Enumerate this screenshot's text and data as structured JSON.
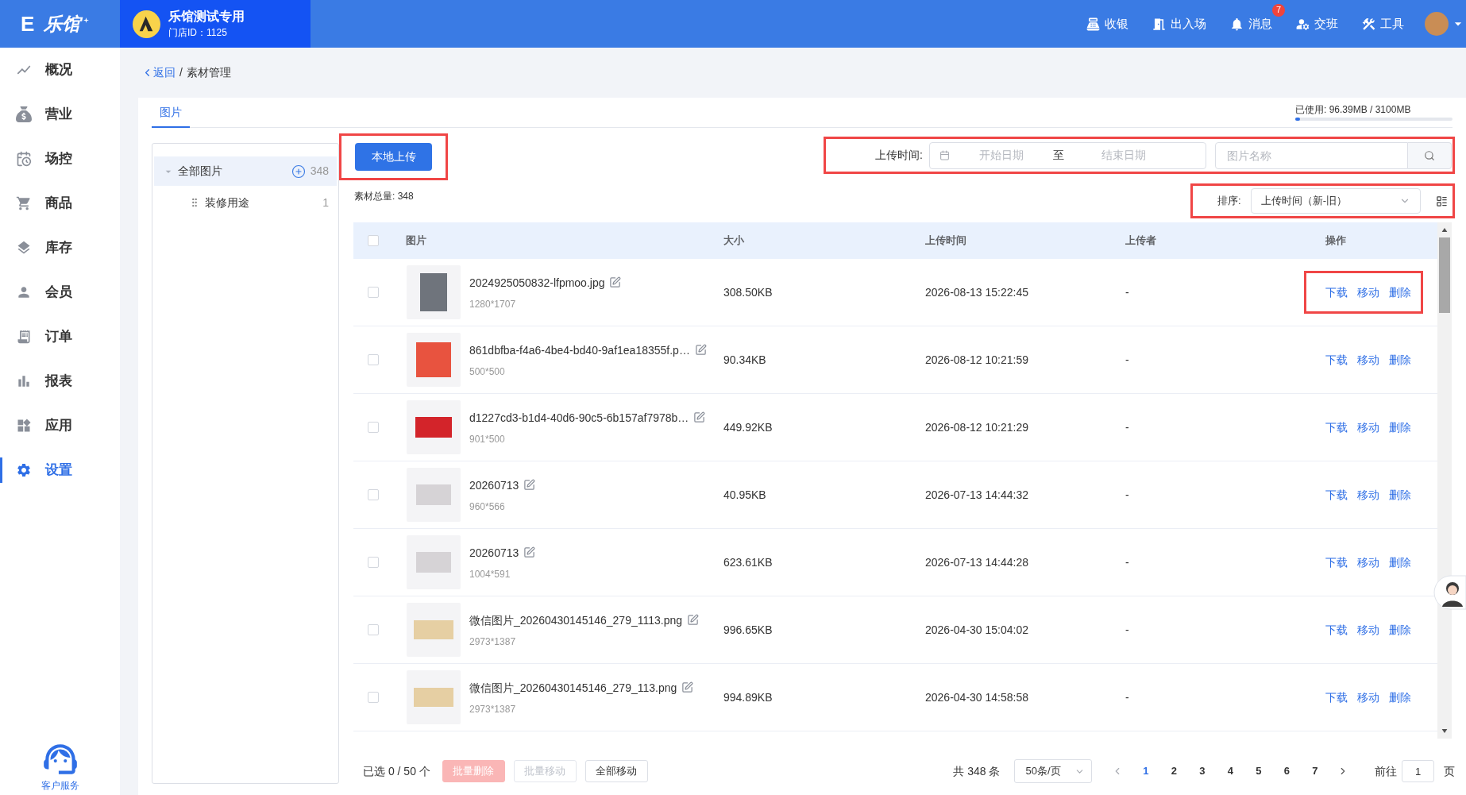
{
  "top_bar": {
    "logo": {
      "mark": "E",
      "name": "乐馆"
    },
    "store": {
      "name": "乐馆测试专用",
      "id": "门店ID：1125"
    },
    "actions": [
      {
        "label": "收银"
      },
      {
        "label": "出入场"
      },
      {
        "label": "消息",
        "badge": "7"
      },
      {
        "label": "交班"
      },
      {
        "label": "工具"
      }
    ]
  },
  "sidebar": {
    "items": [
      {
        "label": "概况",
        "selected": false
      },
      {
        "label": "营业",
        "selected": false
      },
      {
        "label": "场控",
        "selected": false
      },
      {
        "label": "商品",
        "selected": false
      },
      {
        "label": "库存",
        "selected": false
      },
      {
        "label": "会员",
        "selected": false
      },
      {
        "label": "订单",
        "selected": false
      },
      {
        "label": "报表",
        "selected": false
      },
      {
        "label": "应用",
        "selected": false
      },
      {
        "label": "设置",
        "selected": true
      }
    ],
    "support": "客户服务"
  },
  "breadcrumb": {
    "back": "返回",
    "separator": "/",
    "current": "素材管理"
  },
  "tabs": [
    {
      "label": "图片",
      "selected": true
    }
  ],
  "storage": {
    "text": "已使用: 96.39MB / 3100MB",
    "level": 0.031
  },
  "tree": [
    {
      "label": "全部图片",
      "count": "348",
      "selected": true,
      "expanded": true,
      "children": [
        {
          "label": "装修用途",
          "count": "1",
          "selected": false
        }
      ]
    }
  ],
  "toolbar": {
    "upload_button": {
      "label": "本地上传",
      "highlighted": true
    },
    "filter": {
      "label": "上传时间:",
      "start": {
        "placeholder": "开始日期"
      },
      "separator": "至",
      "end": {
        "placeholder": "结束日期"
      },
      "search": {
        "placeholder": "图片名称"
      },
      "highlighted": true
    },
    "total": "素材总量: 348",
    "sort": {
      "label": "排序:",
      "value": "上传时间（新-旧）",
      "highlighted": true
    }
  },
  "table": {
    "select_all": {
      "checked": false
    },
    "columns": [
      "图片",
      "大小",
      "上传时间",
      "上传者",
      "操作"
    ],
    "rows": [
      {
        "checked": false,
        "name": "2024925050832-lfpmoo.jpg",
        "dimensions": "1280*1707",
        "size": "308.50KB",
        "uploaded": "2026-08-13 15:22:45",
        "uploader": "-",
        "actions": [
          "下载",
          "移动",
          "删除"
        ],
        "highlighted": true
      },
      {
        "checked": false,
        "name": "861dbfba-f4a6-4be4-bd40-9af1ea18355f.p…",
        "dimensions": "500*500",
        "size": "90.34KB",
        "uploaded": "2026-08-12 10:21:59",
        "uploader": "-",
        "actions": [
          "下载",
          "移动",
          "删除"
        ],
        "highlighted": false
      },
      {
        "checked": false,
        "name": "d1227cd3-b1d4-40d6-90c5-6b157af7978b…",
        "dimensions": "901*500",
        "size": "449.92KB",
        "uploaded": "2026-08-12 10:21:29",
        "uploader": "-",
        "actions": [
          "下载",
          "移动",
          "删除"
        ],
        "highlighted": false
      },
      {
        "checked": false,
        "name": "20260713",
        "dimensions": "960*566",
        "size": "40.95KB",
        "uploaded": "2026-07-13 14:44:32",
        "uploader": "-",
        "actions": [
          "下载",
          "移动",
          "删除"
        ],
        "highlighted": false
      },
      {
        "checked": false,
        "name": "20260713",
        "dimensions": "1004*591",
        "size": "623.61KB",
        "uploaded": "2026-07-13 14:44:28",
        "uploader": "-",
        "actions": [
          "下载",
          "移动",
          "删除"
        ],
        "highlighted": false
      },
      {
        "checked": false,
        "name": "微信图片_20260430145146_279_1113.png",
        "dimensions": "2973*1387",
        "size": "996.65KB",
        "uploaded": "2026-04-30 15:04:02",
        "uploader": "-",
        "actions": [
          "下载",
          "移动",
          "删除"
        ],
        "highlighted": false
      },
      {
        "checked": false,
        "name": "微信图片_20260430145146_279_113.png",
        "dimensions": "2973*1387",
        "size": "994.89KB",
        "uploaded": "2026-04-30 14:58:58",
        "uploader": "-",
        "actions": [
          "下载",
          "移动",
          "删除"
        ],
        "highlighted": false
      }
    ]
  },
  "footer": {
    "selected_text": "已选 0 / 50 个",
    "buttons": [
      {
        "label": "批量删除",
        "kind": "danger",
        "disabled": true
      },
      {
        "label": "批量移动",
        "kind": "default",
        "disabled": true
      },
      {
        "label": "全部移动",
        "kind": "default",
        "disabled": false
      }
    ],
    "pagination": {
      "total": "共 348 条",
      "page_size": "50条/页",
      "pages": [
        {
          "label": "1",
          "selected": true
        },
        {
          "label": "2",
          "selected": false
        },
        {
          "label": "3",
          "selected": false
        },
        {
          "label": "4",
          "selected": false
        },
        {
          "label": "5",
          "selected": false
        },
        {
          "label": "6",
          "selected": false
        },
        {
          "label": "7",
          "selected": false
        }
      ],
      "goto_label": "前往",
      "goto_value": "1",
      "goto_suffix": "页"
    }
  }
}
